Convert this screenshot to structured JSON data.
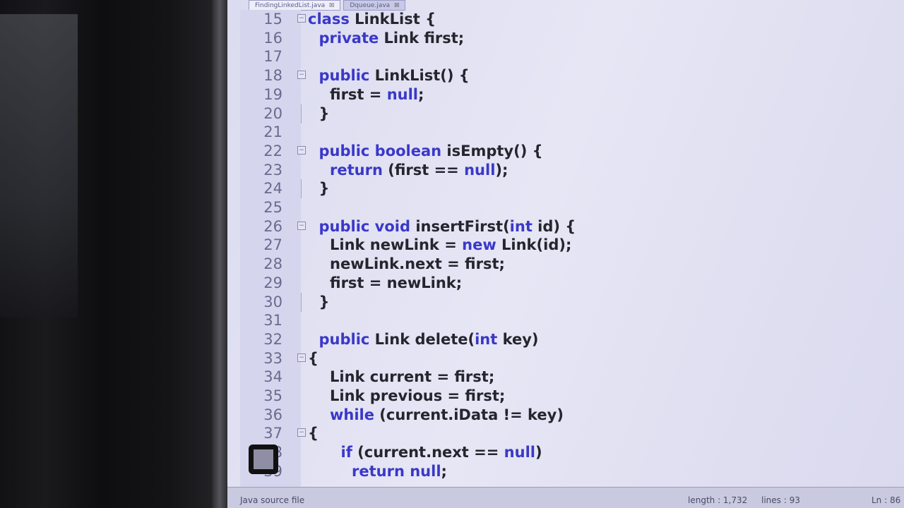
{
  "tabs": [
    {
      "label": "FindingLinkedList.java",
      "close": "☒",
      "active": true
    },
    {
      "label": "Dqueue.java",
      "close": "☒",
      "active": false
    }
  ],
  "lines": [
    {
      "n": "15",
      "indent": 0,
      "fold": "⊟",
      "parts": [
        {
          "t": "class",
          "kw": true
        },
        {
          "t": " LinkList {"
        }
      ]
    },
    {
      "n": "16",
      "indent": 1,
      "parts": [
        {
          "t": "private",
          "kw": true
        },
        {
          "t": " Link first;"
        }
      ]
    },
    {
      "n": "17",
      "indent": 0,
      "parts": []
    },
    {
      "n": "18",
      "indent": 1,
      "fold": "⊟",
      "parts": [
        {
          "t": "public",
          "kw": true
        },
        {
          "t": " LinkList() {"
        }
      ]
    },
    {
      "n": "19",
      "indent": 2,
      "parts": [
        {
          "t": "first = "
        },
        {
          "t": "null",
          "kw": true
        },
        {
          "t": ";"
        }
      ]
    },
    {
      "n": "20",
      "indent": 1,
      "tick": true,
      "parts": [
        {
          "t": "}"
        }
      ]
    },
    {
      "n": "21",
      "indent": 0,
      "parts": []
    },
    {
      "n": "22",
      "indent": 1,
      "fold": "⊟",
      "parts": [
        {
          "t": "public",
          "kw": true
        },
        {
          "t": " "
        },
        {
          "t": "boolean",
          "kw": true
        },
        {
          "t": " isEmpty() {"
        }
      ]
    },
    {
      "n": "23",
      "indent": 2,
      "parts": [
        {
          "t": "return",
          "kw": true
        },
        {
          "t": " (first == "
        },
        {
          "t": "null",
          "kw": true
        },
        {
          "t": ");"
        }
      ]
    },
    {
      "n": "24",
      "indent": 1,
      "tick": true,
      "parts": [
        {
          "t": "}"
        }
      ]
    },
    {
      "n": "25",
      "indent": 0,
      "parts": []
    },
    {
      "n": "26",
      "indent": 1,
      "fold": "⊟",
      "parts": [
        {
          "t": "public",
          "kw": true
        },
        {
          "t": " "
        },
        {
          "t": "void",
          "kw": true
        },
        {
          "t": " insertFirst("
        },
        {
          "t": "int",
          "kw": true
        },
        {
          "t": " id) {"
        }
      ]
    },
    {
      "n": "27",
      "indent": 2,
      "parts": [
        {
          "t": "Link newLink = "
        },
        {
          "t": "new",
          "kw": true
        },
        {
          "t": " Link(id);"
        }
      ]
    },
    {
      "n": "28",
      "indent": 2,
      "parts": [
        {
          "t": "newLink.next = first;"
        }
      ]
    },
    {
      "n": "29",
      "indent": 2,
      "parts": [
        {
          "t": "first = newLink;"
        }
      ]
    },
    {
      "n": "30",
      "indent": 1,
      "tick": true,
      "parts": [
        {
          "t": "}"
        }
      ]
    },
    {
      "n": "31",
      "indent": 0,
      "parts": []
    },
    {
      "n": "32",
      "indent": 1,
      "parts": [
        {
          "t": "public",
          "kw": true
        },
        {
          "t": " Link delete("
        },
        {
          "t": "int",
          "kw": true
        },
        {
          "t": " key)"
        }
      ]
    },
    {
      "n": "33",
      "indent": 0,
      "fold": "⊟",
      "parts": [
        {
          "t": "{"
        }
      ]
    },
    {
      "n": "34",
      "indent": 2,
      "parts": [
        {
          "t": "Link current = first;"
        }
      ]
    },
    {
      "n": "35",
      "indent": 2,
      "parts": [
        {
          "t": "Link previous = first;"
        }
      ]
    },
    {
      "n": "36",
      "indent": 2,
      "parts": [
        {
          "t": "while",
          "kw": true
        },
        {
          "t": " (current.iData != key)"
        }
      ]
    },
    {
      "n": "37",
      "indent": 0,
      "fold": "⊟",
      "parts": [
        {
          "t": "{"
        }
      ]
    },
    {
      "n": "38",
      "indent": 3,
      "parts": [
        {
          "t": "if",
          "kw": true
        },
        {
          "t": " (current.next == "
        },
        {
          "t": "null",
          "kw": true
        },
        {
          "t": ")"
        }
      ]
    },
    {
      "n": "39",
      "indent": 4,
      "parts": [
        {
          "t": "return",
          "kw": true
        },
        {
          "t": " "
        },
        {
          "t": "null",
          "kw": true
        },
        {
          "t": ";"
        }
      ]
    }
  ],
  "status": {
    "file_type": "Java source file",
    "length": "length : 1,732",
    "lines": "lines : 93",
    "position": "Ln : 86"
  }
}
